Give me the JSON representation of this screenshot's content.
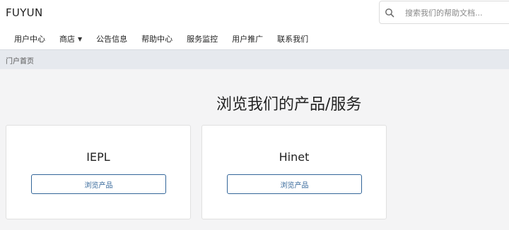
{
  "header": {
    "brand": "FUYUN",
    "search": {
      "placeholder": "搜索我们的帮助文档...",
      "value": "",
      "icon": "search-icon"
    }
  },
  "nav": {
    "items": [
      {
        "label": "用户中心"
      },
      {
        "label": "商店",
        "has_dropdown": true
      },
      {
        "label": "公告信息"
      },
      {
        "label": "帮助中心"
      },
      {
        "label": "服务监控"
      },
      {
        "label": "用户推广"
      },
      {
        "label": "联系我们"
      }
    ]
  },
  "breadcrumb": {
    "current": "门户首页"
  },
  "main": {
    "title": "浏览我们的产品/服务",
    "products": [
      {
        "name": "IEPL",
        "button_label": "浏览产品"
      },
      {
        "name": "Hinet",
        "button_label": "浏览产品"
      }
    ]
  },
  "colors": {
    "accent": "#336699",
    "page_bg": "#f4f4f5",
    "breadcrumb_bg": "#e6e9ee"
  }
}
